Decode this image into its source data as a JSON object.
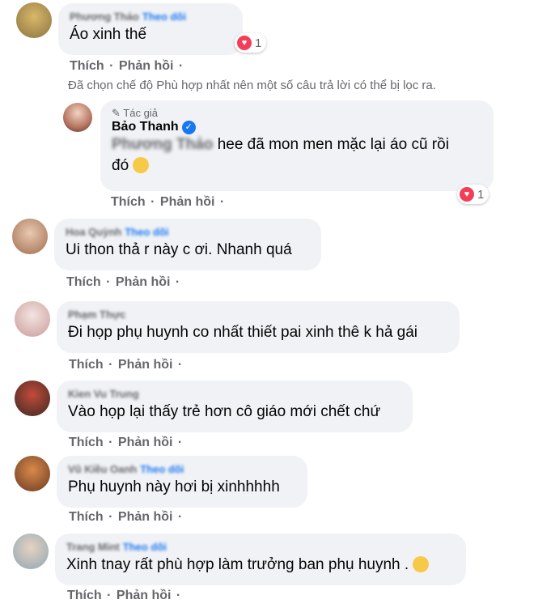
{
  "actions": {
    "like": "Thích",
    "reply": "Phản hồi",
    "sep": "·"
  },
  "filter_note": "Đã chọn chế độ Phù hợp nhất nên một số câu trả lời có thể bị lọc ra.",
  "comments": [
    {
      "name": "Phương Thảo",
      "follow": "Theo dõi",
      "text": "Áo xinh thế",
      "reaction_count": "1"
    },
    {
      "author_tag": "Tác giả",
      "name": "Bảo Thanh",
      "mention": "Phương Thảo",
      "text_line1": "hee đã mon men mặc lại áo cũ rồi",
      "text_line2": "đó",
      "reaction_count": "1"
    },
    {
      "name": "Hoa Quỳnh",
      "follow": "Theo dõi",
      "text": "Ui thon thả r này c ơi. Nhanh quá"
    },
    {
      "name": "Phạm Thực",
      "text": "Đi họp phụ huynh co nhất thiết pai xinh thê k hả gái"
    },
    {
      "name": "Kien Vu Trung",
      "text": "Vào họp lại thấy trẻ hơn cô giáo mới chết chứ"
    },
    {
      "name": "Vũ Kiều Oanh",
      "follow": "Theo dõi",
      "text": "Phụ huynh này hơi bị xinhhhhh"
    },
    {
      "name": "Trang Mint",
      "follow": "Theo dõi",
      "text": "Xinh tnay rất phù hợp làm trưởng ban phụ huynh ."
    }
  ],
  "colors": {
    "bubble": "#f0f2f5",
    "follow": "#1877f2",
    "meta": "#65676b",
    "heart": "#f33e58"
  }
}
